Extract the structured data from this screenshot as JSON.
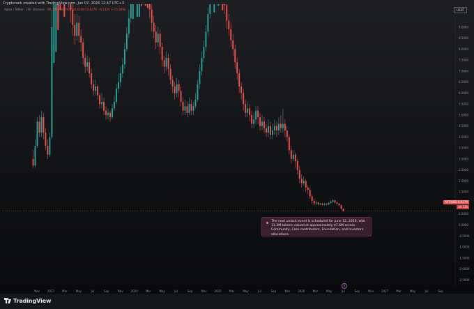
{
  "header": {
    "attribution": "Cryptorank created with TradingView.com, Jun 07, 2026 12:47 UTC+3",
    "symbol_line": "Aptos / Tether · 1W · Binance",
    "ohlc_line": "O0.7403 H0.7407 L0.6148 C0.6279 −0.1124 (−15.18%)",
    "currency": "USDT"
  },
  "chart_data": {
    "type": "candlestick",
    "title": "",
    "xlabel": "",
    "ylabel": "",
    "ylim": [
      -2.65,
      9.6
    ],
    "y_ticks": [
      "9.0000",
      "8.0000",
      "7.0000",
      "6.0000",
      "5.0000",
      "4.0000",
      "3.0000",
      "2.0000",
      "1.0000",
      "0.0000",
      "-1.0000",
      "-2.0000"
    ],
    "y_ticks_half": [
      "8.5000",
      "7.5000",
      "6.5000",
      "5.5000",
      "4.5000",
      "3.5000",
      "2.5000",
      "1.5000",
      "0.5000",
      "-0.5000",
      "-1.5000",
      "-2.5000"
    ],
    "x_ticks": [
      "Nov",
      "2023",
      "Mar",
      "May",
      "Jul",
      "Sep",
      "Nov",
      "2024",
      "Mar",
      "May",
      "Jul",
      "Sep",
      "Nov",
      "2025",
      "Mar",
      "May",
      "Jul",
      "Sep",
      "Nov",
      "2026",
      "Mar",
      "May",
      "Jul",
      "Sep",
      "Nov",
      "2027",
      "Mar",
      "May",
      "Jul",
      "Sep"
    ],
    "last_price": 0.6279,
    "last_price_label": "0.6279",
    "countdown_label": "3d 11h",
    "last_date_label": "APT/USDT",
    "candles": [
      [
        3.0,
        2.7,
        3.4,
        2.6
      ],
      [
        2.7,
        3.6,
        3.9,
        2.6
      ],
      [
        3.6,
        4.7,
        4.9,
        3.5
      ],
      [
        4.7,
        4.2,
        5.0,
        4.0
      ],
      [
        4.2,
        4.9,
        5.2,
        4.0
      ],
      [
        4.9,
        4.2,
        5.1,
        3.9
      ],
      [
        4.2,
        3.6,
        4.4,
        3.4
      ],
      [
        3.6,
        3.2,
        3.9,
        3.0
      ],
      [
        3.2,
        4.0,
        4.2,
        3.1
      ],
      [
        4.0,
        9.0,
        9.8,
        3.9
      ],
      [
        9.0,
        12.5,
        14.0,
        8.6
      ],
      [
        12.5,
        15.5,
        17.0,
        11.8
      ],
      [
        15.5,
        13.5,
        16.0,
        12.8
      ],
      [
        13.5,
        12.4,
        14.0,
        11.5
      ],
      [
        12.4,
        12.9,
        13.8,
        11.9
      ],
      [
        12.9,
        11.5,
        13.3,
        10.9
      ],
      [
        11.5,
        11.0,
        12.0,
        10.4
      ],
      [
        11.0,
        10.4,
        11.5,
        9.9
      ],
      [
        10.4,
        9.8,
        10.9,
        9.2
      ],
      [
        9.8,
        9.1,
        10.2,
        8.6
      ],
      [
        9.1,
        8.6,
        9.6,
        8.2
      ],
      [
        8.6,
        9.2,
        9.6,
        8.4
      ],
      [
        9.2,
        8.6,
        9.5,
        8.3
      ],
      [
        8.6,
        8.3,
        8.9,
        7.9
      ],
      [
        8.3,
        7.6,
        8.5,
        7.3
      ],
      [
        7.6,
        7.2,
        7.8,
        6.9
      ],
      [
        7.2,
        7.4,
        7.7,
        7.0
      ],
      [
        7.4,
        6.9,
        7.6,
        6.7
      ],
      [
        6.9,
        6.4,
        7.1,
        6.2
      ],
      [
        6.4,
        6.1,
        6.6,
        5.9
      ],
      [
        6.1,
        6.3,
        6.6,
        5.9
      ],
      [
        6.3,
        5.9,
        6.4,
        5.7
      ],
      [
        5.9,
        5.5,
        6.0,
        5.3
      ],
      [
        5.5,
        5.6,
        6.0,
        5.3
      ],
      [
        5.6,
        5.2,
        5.8,
        5.0
      ],
      [
        5.2,
        5.0,
        5.4,
        4.8
      ],
      [
        5.0,
        5.1,
        5.3,
        4.8
      ],
      [
        5.1,
        4.9,
        5.2,
        4.7
      ],
      [
        4.9,
        5.3,
        5.5,
        4.8
      ],
      [
        5.3,
        5.6,
        5.9,
        5.2
      ],
      [
        5.6,
        6.2,
        6.4,
        5.5
      ],
      [
        6.2,
        6.5,
        6.9,
        6.0
      ],
      [
        6.5,
        6.9,
        7.2,
        6.3
      ],
      [
        6.9,
        7.3,
        7.6,
        6.7
      ],
      [
        7.3,
        8.0,
        8.3,
        7.1
      ],
      [
        8.0,
        8.7,
        9.0,
        7.9
      ],
      [
        8.7,
        9.4,
        9.8,
        8.5
      ],
      [
        9.4,
        10.5,
        11.0,
        9.2
      ],
      [
        10.5,
        12.0,
        12.6,
        10.2
      ],
      [
        12.0,
        11.2,
        12.5,
        10.8
      ],
      [
        11.2,
        12.6,
        13.4,
        11.0
      ],
      [
        12.6,
        14.0,
        15.0,
        12.3
      ],
      [
        14.0,
        13.1,
        14.5,
        12.6
      ],
      [
        13.1,
        12.4,
        13.6,
        12.0
      ],
      [
        12.4,
        11.5,
        12.8,
        11.1
      ],
      [
        11.5,
        10.5,
        11.8,
        10.1
      ],
      [
        10.5,
        9.8,
        10.9,
        9.4
      ],
      [
        9.8,
        9.2,
        10.1,
        8.8
      ],
      [
        9.2,
        8.8,
        9.5,
        8.5
      ],
      [
        8.8,
        8.3,
        9.1,
        8.0
      ],
      [
        8.3,
        8.7,
        9.0,
        8.1
      ],
      [
        8.7,
        8.1,
        8.9,
        7.8
      ],
      [
        8.1,
        7.5,
        8.3,
        7.2
      ],
      [
        7.5,
        7.2,
        7.7,
        6.9
      ],
      [
        7.2,
        7.6,
        7.9,
        7.0
      ],
      [
        7.6,
        7.1,
        7.8,
        6.8
      ],
      [
        7.1,
        6.6,
        7.3,
        6.4
      ],
      [
        6.6,
        6.3,
        6.8,
        6.0
      ],
      [
        6.3,
        6.0,
        6.5,
        5.7
      ],
      [
        6.0,
        6.4,
        6.7,
        5.8
      ],
      [
        6.4,
        6.1,
        6.6,
        5.8
      ],
      [
        6.1,
        5.6,
        6.3,
        5.4
      ],
      [
        5.6,
        5.2,
        5.8,
        5.0
      ],
      [
        5.2,
        5.4,
        5.7,
        5.0
      ],
      [
        5.4,
        5.1,
        5.6,
        4.9
      ],
      [
        5.1,
        5.5,
        5.8,
        5.0
      ],
      [
        5.5,
        5.2,
        5.7,
        5.0
      ],
      [
        5.2,
        5.4,
        5.6,
        5.0
      ],
      [
        5.4,
        5.7,
        6.0,
        5.3
      ],
      [
        5.7,
        6.4,
        6.6,
        5.6
      ],
      [
        6.4,
        7.0,
        7.3,
        6.2
      ],
      [
        7.0,
        7.6,
        7.9,
        6.8
      ],
      [
        7.6,
        8.1,
        8.4,
        7.4
      ],
      [
        8.1,
        8.8,
        9.1,
        7.9
      ],
      [
        8.8,
        9.6,
        9.9,
        8.6
      ],
      [
        9.6,
        10.4,
        10.9,
        9.4
      ],
      [
        10.4,
        11.2,
        11.8,
        10.1
      ],
      [
        11.2,
        12.4,
        13.0,
        10.9
      ],
      [
        12.4,
        11.7,
        12.9,
        11.3
      ],
      [
        11.7,
        12.6,
        13.2,
        11.4
      ],
      [
        12.6,
        11.9,
        12.9,
        11.5
      ],
      [
        11.9,
        10.8,
        12.2,
        10.4
      ],
      [
        10.8,
        10.0,
        11.1,
        9.6
      ],
      [
        10.0,
        9.3,
        10.3,
        8.9
      ],
      [
        9.3,
        8.9,
        9.6,
        8.6
      ],
      [
        8.9,
        8.4,
        9.2,
        8.1
      ],
      [
        8.4,
        8.0,
        8.7,
        7.7
      ],
      [
        8.0,
        7.4,
        8.2,
        7.1
      ],
      [
        7.4,
        6.9,
        7.6,
        6.6
      ],
      [
        6.9,
        6.3,
        7.1,
        6.0
      ],
      [
        6.3,
        6.0,
        6.5,
        5.7
      ],
      [
        6.0,
        5.5,
        6.2,
        5.2
      ],
      [
        5.5,
        5.1,
        5.7,
        4.9
      ],
      [
        5.1,
        5.3,
        5.6,
        4.9
      ],
      [
        5.3,
        5.0,
        5.5,
        4.7
      ],
      [
        5.0,
        4.6,
        5.2,
        4.4
      ],
      [
        4.6,
        4.8,
        5.1,
        4.4
      ],
      [
        4.8,
        5.2,
        5.4,
        4.6
      ],
      [
        5.2,
        4.9,
        5.4,
        4.6
      ],
      [
        4.9,
        4.5,
        5.1,
        4.3
      ],
      [
        4.5,
        4.7,
        5.0,
        4.3
      ],
      [
        4.7,
        4.4,
        4.9,
        4.2
      ],
      [
        4.4,
        4.2,
        4.6,
        4.0
      ],
      [
        4.2,
        4.5,
        4.8,
        4.0
      ],
      [
        4.5,
        4.1,
        4.7,
        3.9
      ],
      [
        4.1,
        4.3,
        4.6,
        3.9
      ],
      [
        4.3,
        4.5,
        4.8,
        4.1
      ],
      [
        4.5,
        4.3,
        4.7,
        4.0
      ],
      [
        4.3,
        4.6,
        4.9,
        4.1
      ],
      [
        4.6,
        4.4,
        5.0,
        4.2
      ],
      [
        4.4,
        4.6,
        5.3,
        4.2
      ],
      [
        4.6,
        4.3,
        4.8,
        4.0
      ],
      [
        4.3,
        4.0,
        4.5,
        3.8
      ],
      [
        4.0,
        3.4,
        4.1,
        3.2
      ],
      [
        3.4,
        3.0,
        3.6,
        2.8
      ],
      [
        3.0,
        3.2,
        3.4,
        2.9
      ],
      [
        3.2,
        2.9,
        3.3,
        2.6
      ],
      [
        2.9,
        2.5,
        3.0,
        2.3
      ],
      [
        2.5,
        2.1,
        2.7,
        1.9
      ],
      [
        2.1,
        1.9,
        2.3,
        1.7
      ],
      [
        1.9,
        2.0,
        2.2,
        1.8
      ],
      [
        2.0,
        1.7,
        2.1,
        1.5
      ],
      [
        1.7,
        1.6,
        1.8,
        1.4
      ],
      [
        1.6,
        1.3,
        1.7,
        1.2
      ],
      [
        1.3,
        1.1,
        1.4,
        0.95
      ],
      [
        1.1,
        0.98,
        1.2,
        0.9
      ],
      [
        0.98,
        1.02,
        1.1,
        0.9
      ],
      [
        1.02,
        0.94,
        1.05,
        0.88
      ],
      [
        0.94,
        0.97,
        1.0,
        0.9
      ],
      [
        0.97,
        0.92,
        1.0,
        0.87
      ],
      [
        0.92,
        0.96,
        1.0,
        0.88
      ],
      [
        0.96,
        0.93,
        0.99,
        0.88
      ],
      [
        0.93,
        1.0,
        1.05,
        0.9
      ],
      [
        1.0,
        1.06,
        1.12,
        0.97
      ],
      [
        1.06,
        1.12,
        1.18,
        1.0
      ],
      [
        1.12,
        1.02,
        1.15,
        0.98
      ],
      [
        1.02,
        0.97,
        1.05,
        0.92
      ],
      [
        0.97,
        0.9,
        1.0,
        0.85
      ],
      [
        0.9,
        0.74,
        0.92,
        0.7
      ],
      [
        0.74,
        0.63,
        0.74,
        0.61
      ]
    ]
  },
  "annotation": {
    "text": "The next unlock event is scheduled for June 12, 2026, with 11.3M tokens valued at approximately $7.6M across Community, Core contributors, Foundation, and Investors allocations."
  },
  "footer": {
    "brand": "TradingView"
  },
  "colors": {
    "up": "#26a69a",
    "down": "#ef5350",
    "note_bg": "#3b1f2e",
    "background": "#141518"
  }
}
